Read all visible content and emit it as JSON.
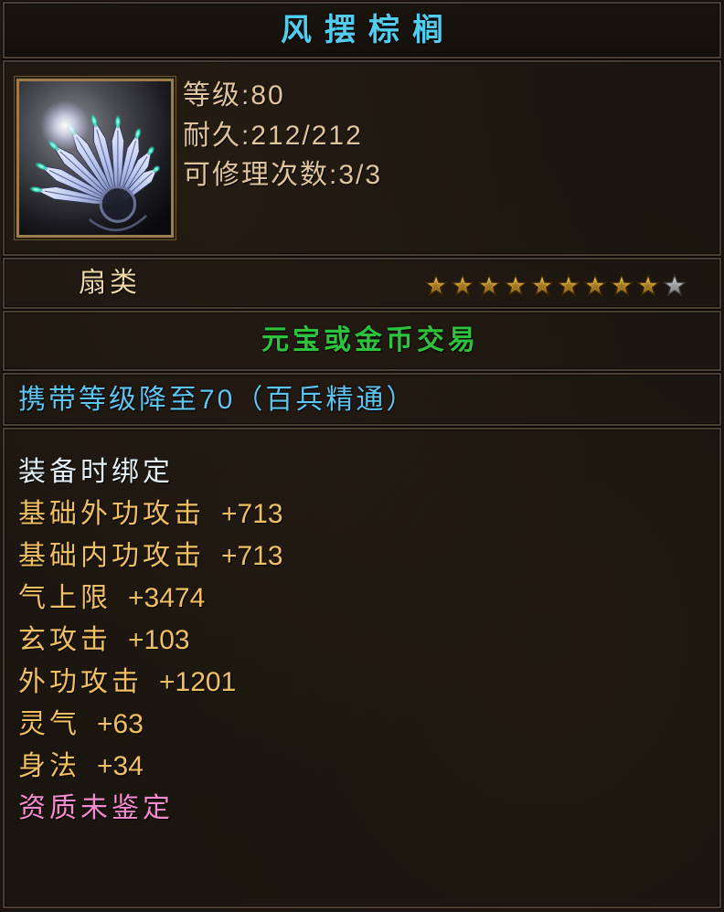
{
  "item": {
    "name": "风摆棕榈",
    "icon": "fan-weapon-icon",
    "stats": [
      "等级:80",
      "耐久:212/212",
      "可修理次数:3/3"
    ],
    "type": "扇类",
    "stars": {
      "filled": 9,
      "total": 10
    },
    "trade": "元宝或金币交易",
    "requirement": "携带等级降至70（百兵精通）",
    "bind": "装备时绑定",
    "attributes": [
      {
        "name": "基础外功攻击",
        "value": "+713"
      },
      {
        "name": "基础内功攻击",
        "value": "+713"
      },
      {
        "name": "气上限",
        "value": "+3474"
      },
      {
        "name": "玄攻击",
        "value": "+103"
      },
      {
        "name": "外功攻击",
        "value": "+1201"
      },
      {
        "name": "灵气",
        "value": "+63"
      },
      {
        "name": "身法",
        "value": "+34"
      }
    ],
    "aptitude": "资质未鉴定"
  },
  "colors": {
    "title": "#52cdf0",
    "stat": "#dfc59c",
    "type": "#f0d8a6",
    "trade": "#2fc23c",
    "req": "#5ec4f0",
    "bind": "#e2f0f6",
    "attr": "#f0c062",
    "aptitude": "#f48ccf",
    "star_filled": "#c89a3a",
    "star_empty": "#a4a4a4"
  }
}
